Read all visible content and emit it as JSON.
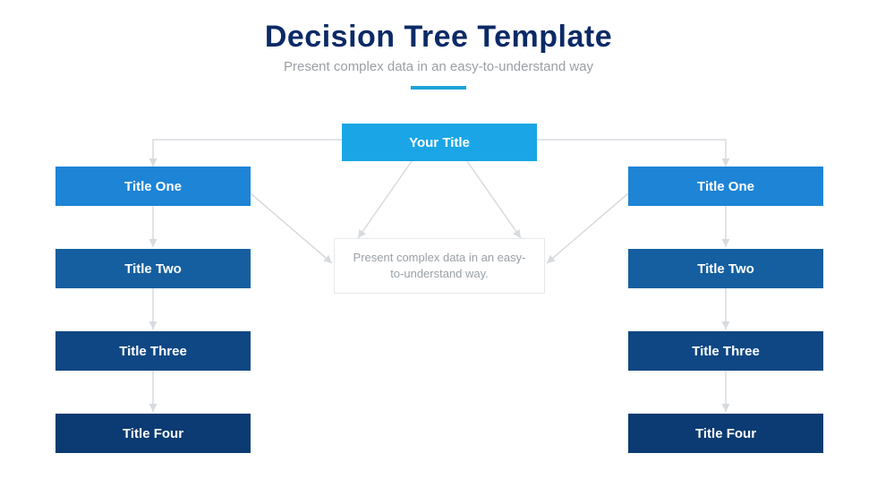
{
  "header": {
    "title": "Decision Tree Template",
    "subtitle": "Present complex data in an easy-to-understand way"
  },
  "root": {
    "label": "Your Title"
  },
  "description": {
    "text": "Present complex data in an easy-to-understand way."
  },
  "left": [
    {
      "label": "Title One"
    },
    {
      "label": "Title Two"
    },
    {
      "label": "Title Three"
    },
    {
      "label": "Title Four"
    }
  ],
  "right": [
    {
      "label": "Title One"
    },
    {
      "label": "Title Two"
    },
    {
      "label": "Title Three"
    },
    {
      "label": "Title Four"
    }
  ]
}
